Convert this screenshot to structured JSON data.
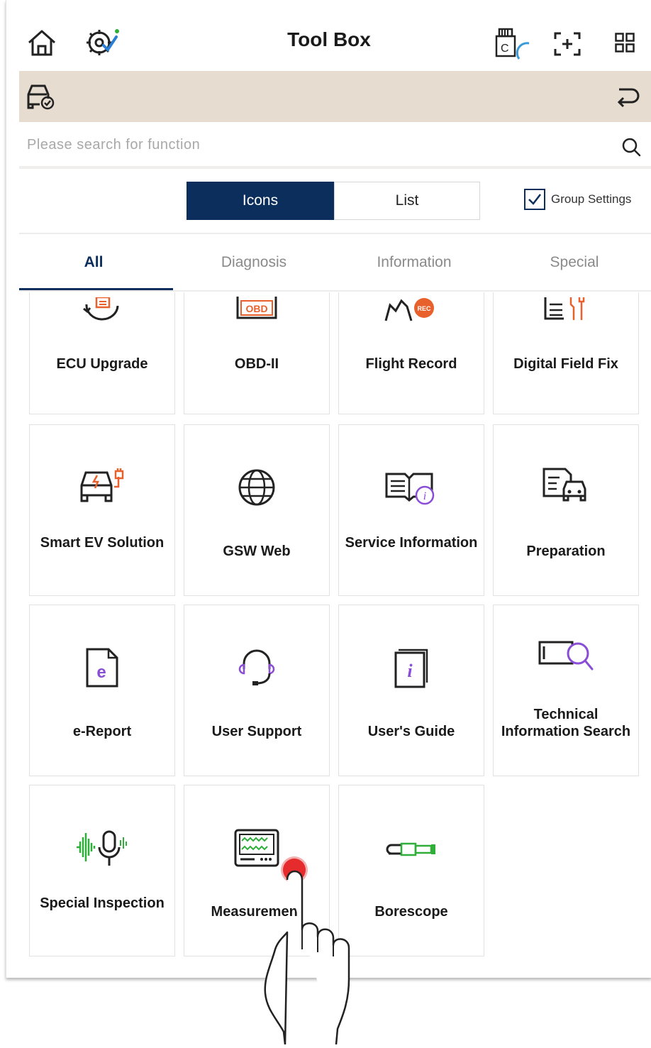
{
  "header": {
    "title": "Tool Box",
    "left_icons": [
      "home-icon",
      "vehicle-settings-icon"
    ],
    "right_icons": [
      "vci-connect-icon",
      "screen-capture-icon",
      "grid-menu-icon"
    ]
  },
  "vehicle_bar": {
    "left_icon": "car-check-icon",
    "right_icon": "return-icon",
    "color": "#e7dcd0"
  },
  "search": {
    "placeholder": "Please search for function",
    "icon": "search-icon"
  },
  "view_toggle": {
    "icons_label": "Icons",
    "list_label": "List",
    "active": "Icons"
  },
  "group_settings": {
    "label": "Group Settings",
    "checked": true
  },
  "tabs": [
    {
      "label": "All",
      "active": true
    },
    {
      "label": "Diagnosis",
      "active": false
    },
    {
      "label": "Information",
      "active": false
    },
    {
      "label": "Special",
      "active": false
    }
  ],
  "tiles": [
    {
      "label": "ECU Upgrade",
      "icon": "ecu-upgrade-icon"
    },
    {
      "label": "OBD-II",
      "icon": "obd-icon",
      "icon_text": "OBD"
    },
    {
      "label": "Flight Record",
      "icon": "flight-record-icon",
      "icon_text": "REC"
    },
    {
      "label": "Digital Field Fix",
      "icon": "digital-field-fix-icon"
    },
    {
      "label": "Smart EV Solution",
      "icon": "ev-car-icon"
    },
    {
      "label": "GSW Web",
      "icon": "globe-icon"
    },
    {
      "label": "Service Information",
      "icon": "book-info-icon"
    },
    {
      "label": "Preparation",
      "icon": "document-car-icon"
    },
    {
      "label": "e-Report",
      "icon": "e-report-icon",
      "icon_text": "e"
    },
    {
      "label": "User Support",
      "icon": "headset-icon"
    },
    {
      "label": "User's Guide",
      "icon": "guide-book-icon",
      "icon_text": "i"
    },
    {
      "label": "Technical Information Search",
      "icon": "tech-search-icon"
    },
    {
      "label": "Special Inspection",
      "icon": "sound-mic-icon"
    },
    {
      "label": "Measurement",
      "icon": "oscilloscope-icon"
    },
    {
      "label": "Borescope",
      "icon": "borescope-icon"
    }
  ],
  "colors": {
    "primary": "#0c2e5c",
    "accent_purple": "#8a4dd6",
    "accent_orange": "#e8612c",
    "accent_green": "#2fae3a",
    "tap": "#e52b2b"
  }
}
